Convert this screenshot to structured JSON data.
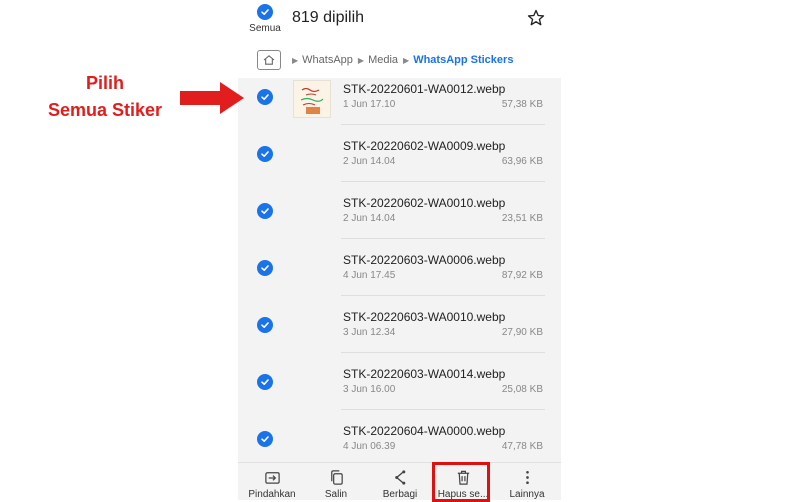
{
  "header": {
    "select_all_label": "Semua",
    "selected_count": "819 dipilih"
  },
  "breadcrumb": {
    "items": [
      "WhatsApp",
      "Media",
      "WhatsApp Stickers"
    ]
  },
  "files": [
    {
      "name": "STK-20220601-WA0012.webp",
      "date": "1 Jun 17.10",
      "size": "57,38 KB"
    },
    {
      "name": "STK-20220602-WA0009.webp",
      "date": "2 Jun 14.04",
      "size": "63,96 KB"
    },
    {
      "name": "STK-20220602-WA0010.webp",
      "date": "2 Jun 14.04",
      "size": "23,51 KB"
    },
    {
      "name": "STK-20220603-WA0006.webp",
      "date": "4 Jun 17.45",
      "size": "87,92 KB"
    },
    {
      "name": "STK-20220603-WA0010.webp",
      "date": "3 Jun 12.34",
      "size": "27,90 KB"
    },
    {
      "name": "STK-20220603-WA0014.webp",
      "date": "3 Jun 16.00",
      "size": "25,08 KB"
    },
    {
      "name": "STK-20220604-WA0000.webp",
      "date": "4 Jun 06.39",
      "size": "47,78 KB"
    }
  ],
  "bottom_bar": {
    "move": "Pindahkan",
    "copy": "Salin",
    "share": "Berbagi",
    "delete": "Hapus se...",
    "more": "Lainnya"
  },
  "annotation": {
    "line1": "Pilih",
    "line2": "Semua Stiker"
  },
  "colors": {
    "accent": "#1a73e8",
    "highlight": "#e01010"
  },
  "icons": [
    "check-icon",
    "star-icon",
    "home-folder-icon",
    "move-icon",
    "copy-icon",
    "share-icon",
    "trash-icon",
    "more-vert-icon",
    "arrow-right-icon"
  ]
}
